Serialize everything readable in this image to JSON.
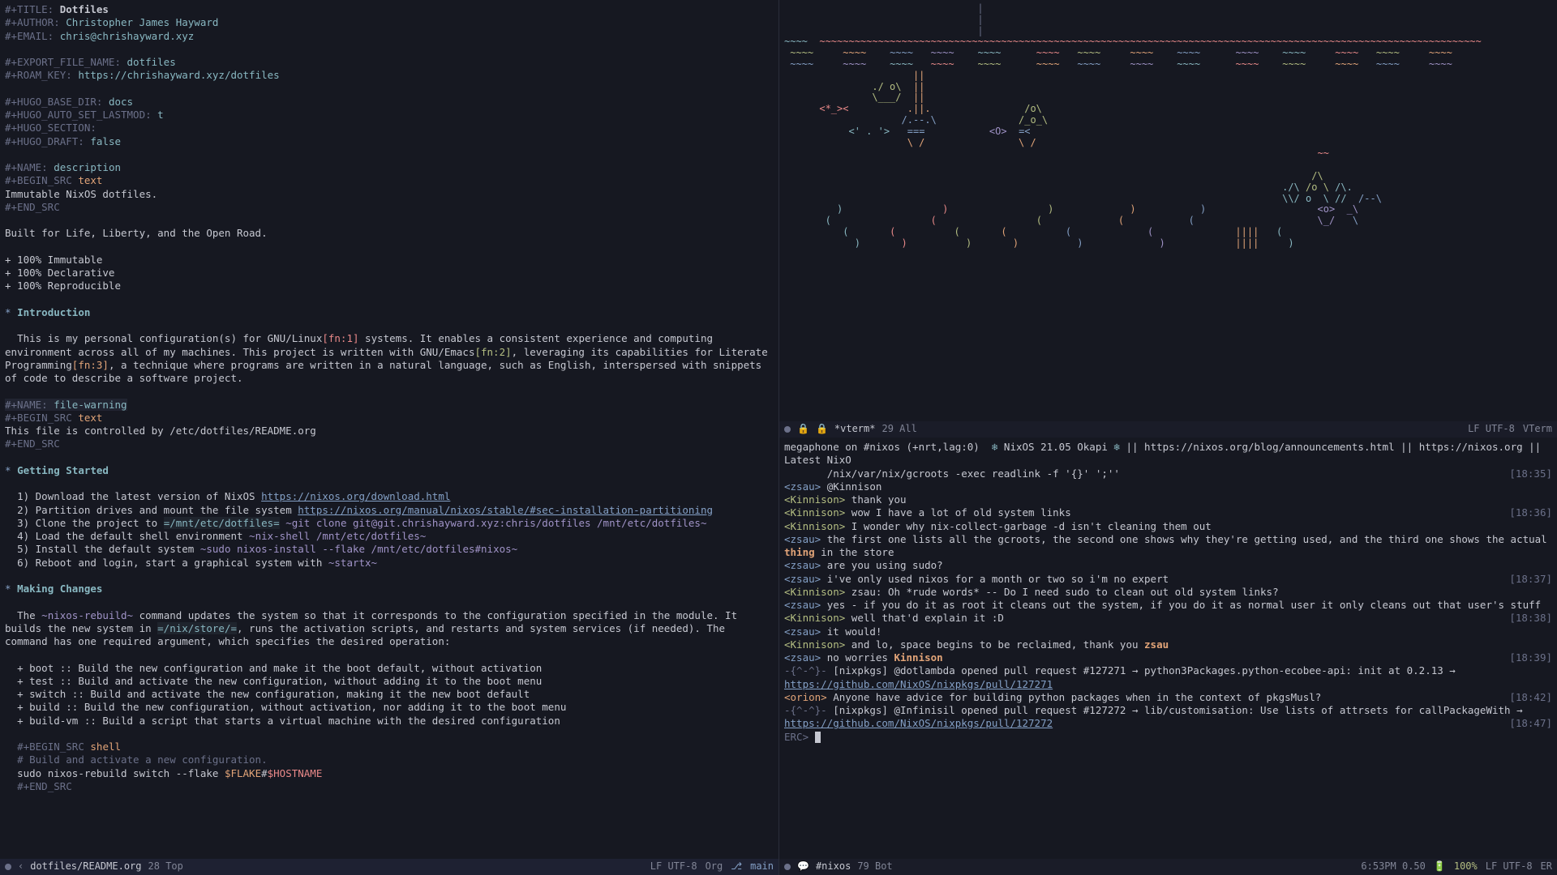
{
  "left": {
    "props": {
      "title_key": "#+TITLE:",
      "title_val": "Dotfiles",
      "author_key": "#+AUTHOR:",
      "author_val": "Christopher James Hayward",
      "email_key": "#+EMAIL:",
      "email_val": "chris@chrishayward.xyz",
      "export_key": "#+EXPORT_FILE_NAME:",
      "export_val": "dotfiles",
      "roam_key": "#+ROAM_KEY:",
      "roam_val": "https://chrishayward.xyz/dotfiles",
      "hugo_base_key": "#+HUGO_BASE_DIR:",
      "hugo_base_val": "docs",
      "hugo_lastmod_key": "#+HUGO_AUTO_SET_LASTMOD:",
      "hugo_lastmod_val": "t",
      "hugo_section_key": "#+HUGO_SECTION:",
      "hugo_draft_key": "#+HUGO_DRAFT:",
      "hugo_draft_val": "false",
      "name_desc_key": "#+NAME:",
      "name_desc_val": "description",
      "begin_src": "#+BEGIN_SRC",
      "end_src": "#+END_SRC",
      "src_text": "text",
      "src_shell": "shell",
      "desc_body": "Immutable NixOS dotfiles.",
      "tagline": "Built for Life, Liberty, and the Open Road.",
      "feat1": "+ 100% Immutable",
      "feat2": "+ 100% Declarative",
      "feat3": "+ 100% Reproducible",
      "h_intro": "Introduction",
      "intro_p1a": "This is my personal configuration(s) for GNU/Linux",
      "intro_fn1": "[fn:1]",
      "intro_p1b": " systems. It enables a consistent experience and computing environment across all of my machines. This project is written with GNU/Emacs",
      "intro_fn2": "[fn:2]",
      "intro_p1c": ", leveraging its capabilities for Literate Programming",
      "intro_fn3": "[fn:3]",
      "intro_p1d": ", a technique where programs are written in a natural language, such as English, interspersed with snippets of code to describe a software project.",
      "name_warn_key": "#+NAME:",
      "name_warn_val": "file-warning",
      "warn_body": "This file is controlled by /etc/dotfiles/README.org",
      "h_getting": "Getting Started",
      "gs1a": "1) Download the latest version of NixOS ",
      "gs1b": "https://nixos.org/download.html",
      "gs2a": "2) Partition drives and mount the file system ",
      "gs2b": "https://nixos.org/manual/nixos/stable/#sec-installation-partitioning",
      "gs3a": "3) Clone the project to ",
      "gs3b": "=/mnt/etc/dotfiles=",
      "gs3c": " ~git clone git@git.chrishayward.xyz:chris/dotfiles /mnt/etc/dotfiles~",
      "gs4a": "4) Load the default shell environment ",
      "gs4b": "~nix-shell /mnt/etc/dotfiles~",
      "gs5a": "5) Install the default system ",
      "gs5b": "~sudo nixos-install --flake /mnt/etc/dotfiles#nixos~",
      "gs6a": "6) Reboot and login, start a graphical system with ",
      "gs6b": "~startx~",
      "h_changes": "Making Changes",
      "mc_p1a": "The ",
      "mc_p1b": "~nixos-rebuild~",
      "mc_p1c": " command updates the system so that it corresponds to the configuration specified in the module. It builds the new system in ",
      "mc_p1d": "=/nix/store/=",
      "mc_p1e": ", runs the activation scripts, and restarts and system services (if needed). The command has one required argument, which specifies the desired operation:",
      "op1": "+ boot :: Build the new configuration and make it the boot default, without activation",
      "op2": "+ test :: Build and activate the new configuration, without adding it to the boot menu",
      "op3": "+ switch :: Build and activate the new configuration, making it the new boot default",
      "op4": "+ build :: Build the new configuration, without activation, nor adding it to the boot menu",
      "op5": "+ build-vm :: Build a script that starts a virtual machine with the desired configuration",
      "shell_comment": "# Build and activate a new configuration.",
      "shell_cmd_a": "sudo nixos-rebuild switch --flake ",
      "shell_cmd_b": "$FLAKE",
      "shell_cmd_c": "#",
      "shell_cmd_d": "$HOSTNAME"
    },
    "modeline": {
      "file": "dotfiles/README.org",
      "pos": "28 Top",
      "encoding": "LF UTF-8",
      "mode": "Org",
      "branch": "main"
    }
  },
  "vterm": {
    "modeline": {
      "buf": "*vterm*",
      "pos": "29 All",
      "encoding": "LF UTF-8",
      "mode": "VTerm"
    }
  },
  "irc": {
    "topic_a": "megaphone on #nixos (+nrt,lag:0)  ",
    "topic_b": " NixOS 21.05 Okapi ",
    "topic_c": " || https://nixos.org/blog/announcements.html || https://nixos.org || Latest NixO",
    "topic_cmd": "/nix/var/nix/gcroots -exec readlink -f '{}' ';''",
    "lines": [
      {
        "t": "[18:35]",
        "n": "<zsau>",
        "c": "nick",
        "x": "@Kinnison"
      },
      {
        "t": "",
        "n": "<Kinnison>",
        "c": "nick2",
        "x": "thank you"
      },
      {
        "t": "[18:36]",
        "n": "<Kinnison>",
        "c": "nick2",
        "x": "wow I have a lot of old system links"
      },
      {
        "t": "",
        "n": "<Kinnison>",
        "c": "nick2",
        "x": "I wonder why nix-collect-garbage -d isn't cleaning them out"
      },
      {
        "t": "",
        "n": "<zsau>",
        "c": "nick",
        "x": "the first one lists all the gcroots, the second one shows why they're getting used, and the third one shows the actual",
        "hl": "thing",
        "x2": " in the store"
      },
      {
        "t": "",
        "n": "<zsau>",
        "c": "nick",
        "x": "are you using sudo?"
      },
      {
        "t": "[18:37]",
        "n": "<zsau>",
        "c": "nick",
        "x": "i've only used nixos for a month or two so i'm no expert"
      },
      {
        "t": "",
        "n": "<Kinnison>",
        "c": "nick2",
        "x": "zsau: Oh *rude words* -- Do I need sudo to clean out old system links?"
      },
      {
        "t": "",
        "n": "<zsau>",
        "c": "nick",
        "x": "yes - if you do it as root it cleans out the system, if you do it as normal user it only cleans out that user's stuff"
      },
      {
        "t": "[18:38]",
        "n": "<Kinnison>",
        "c": "nick2",
        "x": "well that'd explain it :D"
      },
      {
        "t": "",
        "n": "<zsau>",
        "c": "nick",
        "x": "it would!"
      },
      {
        "t": "",
        "n": "<Kinnison>",
        "c": "nick2",
        "x": "and lo, space begins to be reclaimed, thank you ",
        "hl": "zsau"
      },
      {
        "t": "[18:39]",
        "n": "<zsau>",
        "c": "nick",
        "x": "no worries ",
        "hl": "Kinnison"
      },
      {
        "t": "",
        "n": "-{^-^}-",
        "c": "bot-prefix",
        "x": "[nixpkgs] @dotlambda opened pull request #127271 → python3Packages.python-ecobee-api: init at 0.2.13 → ",
        "url": "https://github.com/NixOS/nixpkgs/pull/127271"
      },
      {
        "t": "[18:42]",
        "n": "<orion>",
        "c": "nick3",
        "x": "Anyone have advice for building python packages when in the context of pkgsMusl?"
      },
      {
        "t": "",
        "n": "-{^-^}-",
        "c": "bot-prefix",
        "x": "[nixpkgs] @Infinisil opened pull request #127272 → lib/customisation: Use lists of attrsets for callPackageWith → ",
        "url": "https://github.com/NixOS/nixpkgs/pull/127272"
      },
      {
        "t": "[18:47]",
        "n": "",
        "c": "",
        "x": ""
      }
    ],
    "prompt": "ERC>",
    "modeline": {
      "buf": "#nixos",
      "pos": "79 Bot",
      "time": "6:53PM 0.50",
      "battery": "100%",
      "encoding": "LF UTF-8",
      "mode": "ER"
    }
  }
}
